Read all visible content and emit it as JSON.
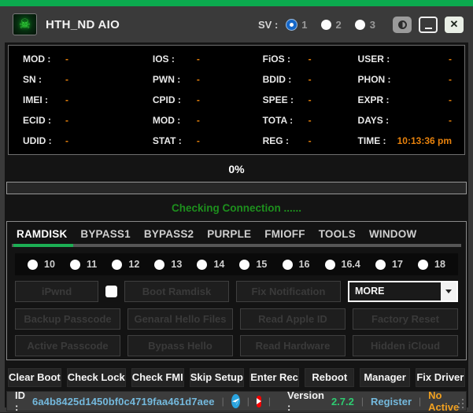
{
  "titlebar": {
    "app_title": "HTH_ND AIO",
    "skull_icon": "☠",
    "sv_label": "SV :",
    "sv_selected": "1",
    "sv_options": [
      {
        "label": "1"
      },
      {
        "label": "2"
      },
      {
        "label": "3"
      }
    ],
    "close_glyph": "✕"
  },
  "info_panel": {
    "columns": [
      {
        "rows": [
          {
            "label": "MOD :",
            "value": "-"
          },
          {
            "label": "SN :",
            "value": "-"
          },
          {
            "label": "IMEI :",
            "value": "-"
          },
          {
            "label": "ECID :",
            "value": "-"
          },
          {
            "label": "UDID :",
            "value": "-"
          }
        ]
      },
      {
        "rows": [
          {
            "label": "IOS :",
            "value": "-"
          },
          {
            "label": "PWN :",
            "value": "-"
          },
          {
            "label": "CPID :",
            "value": "-"
          },
          {
            "label": "MOD :",
            "value": "-"
          },
          {
            "label": "STAT :",
            "value": "-"
          }
        ]
      },
      {
        "rows": [
          {
            "label": "FiOS :",
            "value": "-"
          },
          {
            "label": "BDID :",
            "value": "-"
          },
          {
            "label": "SPEE :",
            "value": "-"
          },
          {
            "label": "TOTA :",
            "value": "-"
          },
          {
            "label": "REG :",
            "value": "-"
          }
        ]
      },
      {
        "rows": [
          {
            "label": "USER :",
            "value": "-"
          },
          {
            "label": "PHON :",
            "value": "-"
          },
          {
            "label": "EXPR :",
            "value": "-"
          },
          {
            "label": "DAYS :",
            "value": "-"
          },
          {
            "label": "TIME :",
            "value": "10:13:36 pm"
          }
        ]
      }
    ]
  },
  "progress": {
    "percent": "0%",
    "status_text": "Checking Connection ......"
  },
  "tabs": [
    {
      "label": "RAMDISK"
    },
    {
      "label": "BYPASS1"
    },
    {
      "label": "BYPASS2"
    },
    {
      "label": "PURPLE"
    },
    {
      "label": "FMIOFF"
    },
    {
      "label": "TOOLS"
    },
    {
      "label": "WINDOW"
    }
  ],
  "active_tab": "RAMDISK",
  "ios_versions": [
    {
      "label": "10"
    },
    {
      "label": "11"
    },
    {
      "label": "12"
    },
    {
      "label": "13"
    },
    {
      "label": "14"
    },
    {
      "label": "15"
    },
    {
      "label": "16"
    },
    {
      "label": "16.4"
    },
    {
      "label": "17"
    },
    {
      "label": "18"
    }
  ],
  "actions": {
    "row1": {
      "ipwnd": "iPwnd",
      "boot_ramdisk": "Boot Ramdisk",
      "fix_notification": "Fix Notification",
      "more_dropdown": "MORE"
    },
    "row2": [
      {
        "label": "Backup Passcode"
      },
      {
        "label": "Genaral Hello Files"
      },
      {
        "label": "Read Apple ID"
      },
      {
        "label": "Factory Reset"
      }
    ],
    "row3": [
      {
        "label": "Active Passcode"
      },
      {
        "label": "Bypass Hello"
      },
      {
        "label": "Read Hardware"
      },
      {
        "label": "Hidden iCloud"
      }
    ]
  },
  "bottom_buttons": [
    {
      "label": "Clear Boot"
    },
    {
      "label": "Check Lock"
    },
    {
      "label": "Check FMI"
    },
    {
      "label": "Skip Setup"
    },
    {
      "label": "Enter Rec"
    },
    {
      "label": "Reboot"
    },
    {
      "label": "Manager"
    },
    {
      "label": "Fix Driver"
    }
  ],
  "status_bar": {
    "id_label": "ID :",
    "id_value": "6a4b8425d1450bf0c4719faa461d7aee",
    "separator": "|",
    "version_label": "Version :",
    "version_value": "2.7.2",
    "register_label": "Register",
    "activation_status": "No Active"
  },
  "colors": {
    "top_accent_green": "#0baa4e",
    "tab_active_green": "#1caf54",
    "value_orange": "#e8820c",
    "status_green": "#1d8f1d",
    "version_green": "#2ecc71",
    "link_blue": "#74b9dd",
    "warning_orange": "#f0a020",
    "telegram_blue": "#2aa4df",
    "youtube_red": "#f60000"
  }
}
